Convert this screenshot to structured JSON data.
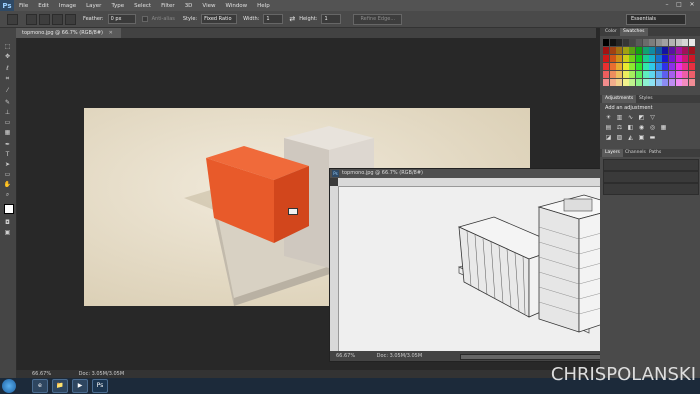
{
  "app": {
    "logo": "Ps"
  },
  "menu": [
    "File",
    "Edit",
    "Image",
    "Layer",
    "Type",
    "Select",
    "Filter",
    "3D",
    "View",
    "Window",
    "Help"
  ],
  "window_controls": {
    "min": "–",
    "max": "□",
    "close": "✕"
  },
  "options": {
    "feather_label": "Feather:",
    "feather_value": "0 px",
    "anti_alias": "Anti-alias",
    "style_label": "Style:",
    "style_value": "Fixed Ratio",
    "width_label": "Width:",
    "width_value": "1",
    "swap_icon": "⇄",
    "height_label": "Height:",
    "height_value": "1",
    "refine_edge": "Refine Edge...",
    "workspace": "Essentials"
  },
  "main_doc": {
    "tab_title": "topmono.jpg @ 66.7% (RGB/8#)",
    "zoom": "66.67%",
    "doc_info": "Doc: 3.05M/3.05M"
  },
  "float_doc": {
    "title": "topmono.jpg @ 66.7% (RGB/8#)",
    "zoom": "66.67%",
    "doc_info": "Doc: 3.05M/3.05M"
  },
  "panels": {
    "color_tab": "Color",
    "swatches_tab": "Swatches",
    "adjustments_tab": "Adjustments",
    "styles_tab": "Styles",
    "add_adjustment": "Add an adjustment",
    "layers_tab": "Layers",
    "channels_tab": "Channels",
    "paths_tab": "Paths"
  },
  "taskbar": {
    "apps": [
      "e",
      "📁",
      "▶",
      "Ps"
    ]
  },
  "watermark": "CHRISPOLANSKI"
}
